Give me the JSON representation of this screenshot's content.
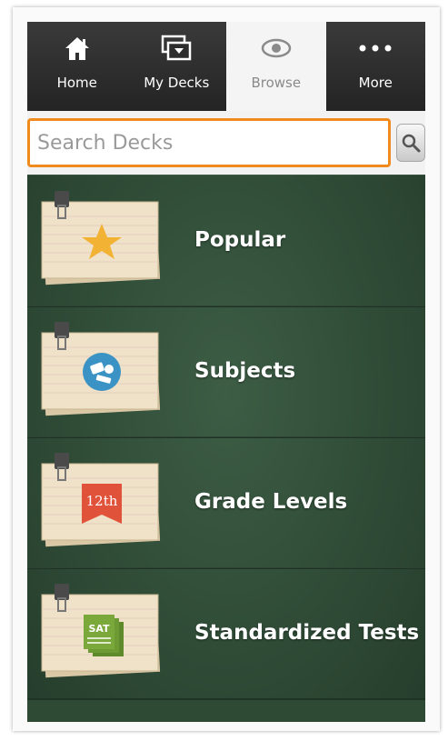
{
  "tabs": [
    {
      "label": "Home",
      "icon": "home-icon",
      "selected": false
    },
    {
      "label": "My Decks",
      "icon": "decks-icon",
      "selected": false
    },
    {
      "label": "Browse",
      "icon": "eye-icon",
      "selected": true
    },
    {
      "label": "More",
      "icon": "more-icon",
      "selected": false
    }
  ],
  "search": {
    "placeholder": "Search Decks",
    "value": ""
  },
  "categories": [
    {
      "label": "Popular",
      "icon": "star-icon"
    },
    {
      "label": "Subjects",
      "icon": "subjects-globe-icon"
    },
    {
      "label": "Grade Levels",
      "icon": "grade-12th-icon",
      "badge": "12th"
    },
    {
      "label": "Standardized Tests",
      "icon": "sat-icon",
      "badge": "SAT"
    }
  ],
  "colors": {
    "accent": "#f08a1c",
    "star": "#f2b233",
    "subjects": "#3a93c4",
    "grade": "#e0523a",
    "sat": "#7aa83b",
    "board": "#2f4b38"
  }
}
